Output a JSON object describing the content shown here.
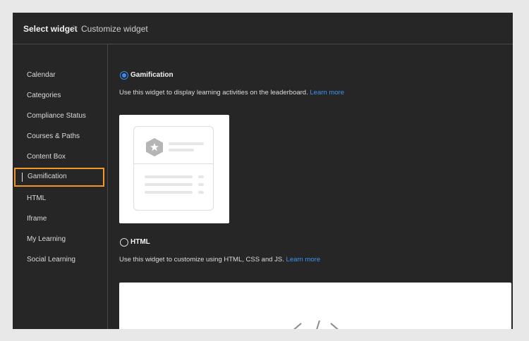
{
  "breadcrumb": {
    "current": "Select widget",
    "separator": ">",
    "next": "Customize widget"
  },
  "sidebar": {
    "items": [
      {
        "label": "Calendar"
      },
      {
        "label": "Categories"
      },
      {
        "label": "Compliance Status"
      },
      {
        "label": "Courses & Paths"
      },
      {
        "label": "Content Box"
      },
      {
        "label": "Gamification",
        "selected": true
      },
      {
        "label": "HTML"
      },
      {
        "label": "Iframe"
      },
      {
        "label": "My Learning"
      },
      {
        "label": "Social Learning"
      }
    ]
  },
  "options": [
    {
      "title": "Gamification",
      "selected": true,
      "description": "Use this widget to display learning activities on the leaderboard.",
      "link": "Learn more",
      "preview_icon": "leaderboard-card-icon"
    },
    {
      "title": "HTML",
      "selected": false,
      "description": "Use this widget to customize using HTML, CSS and JS.",
      "link": "Learn more",
      "preview_icon": "code-brackets-icon"
    }
  ],
  "colors": {
    "accent": "#3b8cf0",
    "selection_border": "#f0962a",
    "panel_bg": "#262626"
  }
}
